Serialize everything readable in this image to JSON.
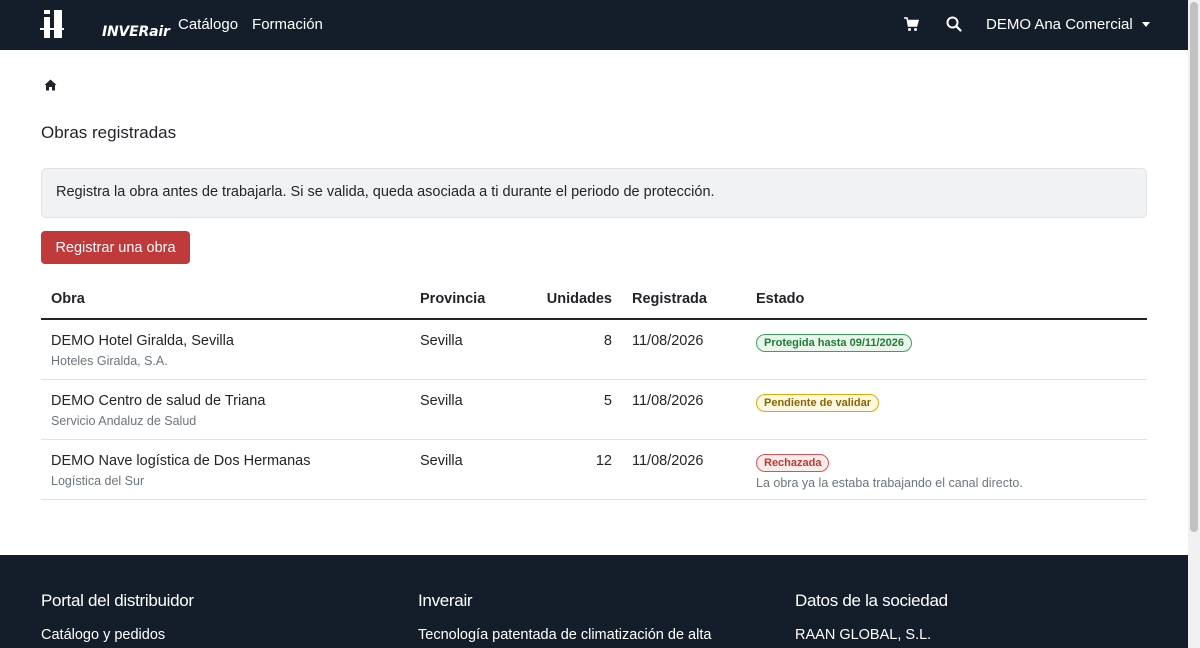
{
  "navbar": {
    "brand": "INVERair",
    "links": [
      "Catálogo",
      "Formación"
    ],
    "cart_icon": "cart-icon",
    "search_icon": "search-icon",
    "user": "DEMO Ana Comercial"
  },
  "breadcrumb": {
    "icon": "home-icon"
  },
  "page": {
    "title": "Obras registradas",
    "alert": "Registra la obra antes de trabajarla. Si se valida, queda asociada a ti durante el periodo de protección.",
    "register_button": "Registrar una obra"
  },
  "table": {
    "headers": [
      "Obra",
      "Provincia",
      "Unidades",
      "Registrada",
      "Estado"
    ],
    "rows": [
      {
        "obra": "DEMO Hotel Giralda, Sevilla",
        "cliente": "Hoteles Giralda, S.A.",
        "provincia": "Sevilla",
        "unidades": "8",
        "registrada": "11/08/2026",
        "estado": "Protegida hasta 09/11/2026",
        "estado_color": "#1e7e34",
        "motivo": ""
      },
      {
        "obra": "DEMO Centro de salud de Triana",
        "cliente": "Servicio Andaluz de Salud",
        "provincia": "Sevilla",
        "unidades": "5",
        "registrada": "11/08/2026",
        "estado": "Pendiente de validar",
        "estado_color": "#8a6500",
        "motivo": ""
      },
      {
        "obra": "DEMO Nave logística de Dos Hermanas",
        "cliente": "Logística del Sur",
        "provincia": "Sevilla",
        "unidades": "12",
        "registrada": "11/08/2026",
        "estado": "Rechazada",
        "estado_color": "#c0392b",
        "motivo": "La obra ya la estaba trabajando el canal directo."
      }
    ]
  },
  "footer": {
    "col1": {
      "title": "Portal del distribuidor",
      "item": "Catálogo y pedidos"
    },
    "col2": {
      "title": "Inverair",
      "item": "Tecnología patentada de climatización de alta"
    },
    "col3": {
      "title": "Datos de la sociedad",
      "item": "RAAN GLOBAL, S.L."
    }
  },
  "colors": {
    "navbar_bg": "#141e2a",
    "accent": "#c0393b"
  }
}
